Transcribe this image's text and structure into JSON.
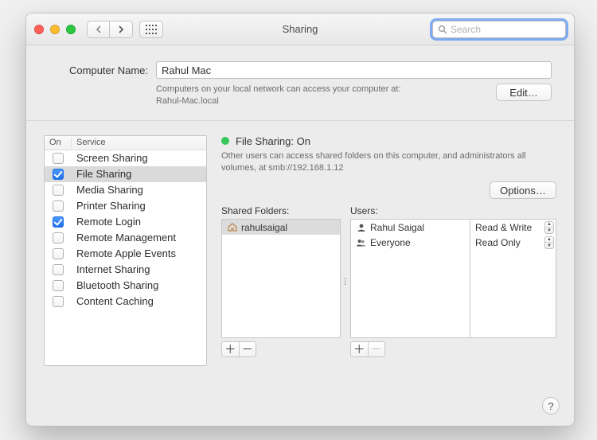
{
  "titlebar": {
    "title": "Sharing",
    "search_placeholder": "Search"
  },
  "top": {
    "label": "Computer Name:",
    "computer_name": "Rahul Mac",
    "desc_l1": "Computers on your local network can access your computer at:",
    "desc_l2": "Rahul-Mac.local",
    "edit_btn": "Edit…"
  },
  "services": {
    "col_on": "On",
    "col_service": "Service",
    "items": [
      {
        "label": "Screen Sharing",
        "on": false,
        "selected": false
      },
      {
        "label": "File Sharing",
        "on": true,
        "selected": true
      },
      {
        "label": "Media Sharing",
        "on": false,
        "selected": false
      },
      {
        "label": "Printer Sharing",
        "on": false,
        "selected": false
      },
      {
        "label": "Remote Login",
        "on": true,
        "selected": false
      },
      {
        "label": "Remote Management",
        "on": false,
        "selected": false
      },
      {
        "label": "Remote Apple Events",
        "on": false,
        "selected": false
      },
      {
        "label": "Internet Sharing",
        "on": false,
        "selected": false
      },
      {
        "label": "Bluetooth Sharing",
        "on": false,
        "selected": false
      },
      {
        "label": "Content Caching",
        "on": false,
        "selected": false
      }
    ]
  },
  "detail": {
    "status_label": "File Sharing: On",
    "status_desc": "Other users can access shared folders on this computer, and administrators all volumes, at smb://192.168.1.12",
    "options_btn": "Options…",
    "shared_label": "Shared Folders:",
    "users_label": "Users:",
    "shared_items": [
      {
        "label": "rahulsaigal",
        "selected": true
      }
    ],
    "users_items": [
      {
        "label": "Rahul Saigal",
        "perm": "Read & Write"
      },
      {
        "label": "Everyone",
        "perm": "Read Only"
      }
    ]
  },
  "footer": {
    "help": "?"
  }
}
